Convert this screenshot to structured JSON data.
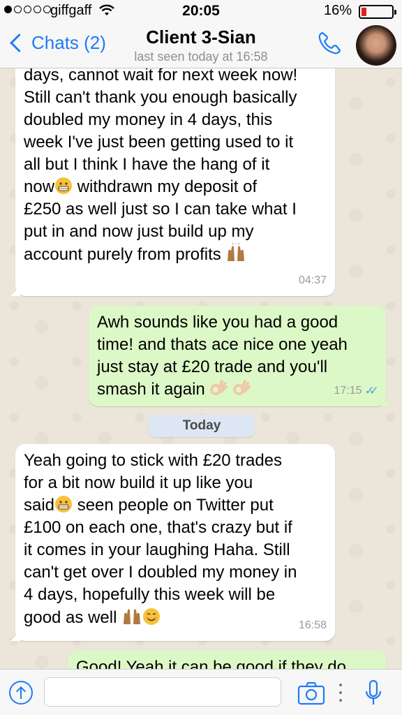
{
  "status_bar": {
    "carrier": "giffgaff",
    "time": "20:05",
    "battery_pct": "16%",
    "battery_level": 0.16,
    "signal_bars": 1,
    "battery_color": "#e0201b"
  },
  "nav": {
    "back_label": "Chats (2)",
    "title": "Client 3-Sian",
    "subtitle": "last seen today at 16:58",
    "accent": "#1f7cf2"
  },
  "messages": [
    {
      "direction": "in",
      "lines": "days, cannot wait for next week now!\nStill can't thank you enough basically\ndoubled my money in 4 days, this\nweek I've just been getting used to it\nall but I think I have the hang of it",
      "line6_a": "now",
      "line6_b": " withdrawn my deposit of",
      "lines_tail": "£250 as well just so I can take what I\nput in and now just build up my",
      "last_line": "account purely from profits ",
      "time": "04:37"
    },
    {
      "direction": "out",
      "lines": "Awh sounds like you had a good\ntime! and thats ace nice one yeah\njust stay at £20 trade and you'll",
      "last_line": "smash it again ",
      "time": "17:15"
    },
    {
      "direction": "in",
      "lines": "Yeah going to stick with £20 trades\nfor a bit now build it up like you",
      "line3_a": "said",
      "line3_b": " seen people on Twitter put",
      "lines_tail": "£100 on each one, that's crazy but if\nit comes in your laughing Haha. Still\ncan't get over I doubled my money in\n4 days, hopefully this week will be",
      "last_line": "good as well ",
      "time": "16:58"
    },
    {
      "direction": "out",
      "lines": "Good! Yeah it can be good if they do"
    }
  ],
  "date_divider": "Today",
  "input": {
    "value": "",
    "placeholder": ""
  },
  "icons": [
    "share-icon",
    "camera-icon",
    "more-icon",
    "microphone-icon",
    "phone-icon",
    "back-chevron-icon",
    "grimace-emoji",
    "raised-hands-emoji",
    "ok-hand-emoji",
    "smiling-emoji"
  ]
}
